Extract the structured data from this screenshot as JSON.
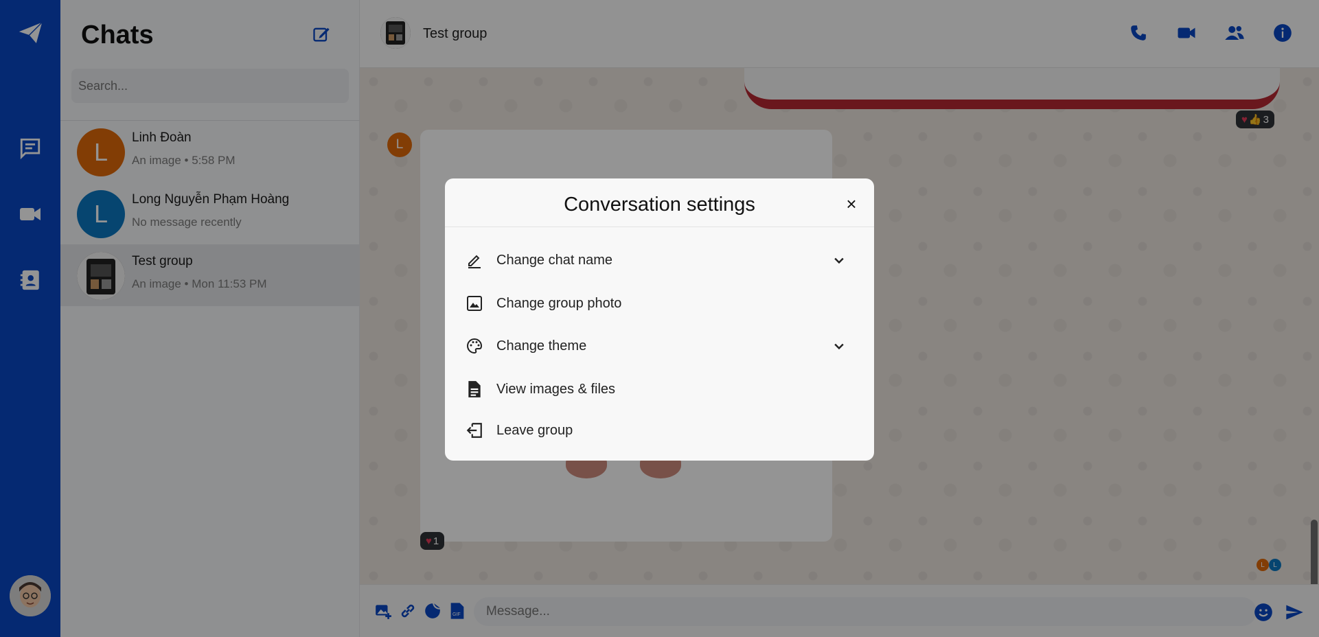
{
  "sidebar": {
    "nav_icons": [
      "paper-plane-icon",
      "chat-icon",
      "video-icon",
      "contacts-icon"
    ],
    "accent": "#0a47c4"
  },
  "chat_list": {
    "title": "Chats",
    "search_placeholder": "Search...",
    "items": [
      {
        "initial": "L",
        "name": "Linh Đoàn",
        "preview": "An image • 5:58 PM",
        "avatar_color": "#e0690a"
      },
      {
        "initial": "L",
        "name": "Long Nguyễn Phạm Hoàng",
        "preview": "No message recently",
        "avatar_color": "#0b78c2"
      },
      {
        "initial": "",
        "name": "Test group",
        "preview": "An image • Mon 11:53 PM",
        "avatar_color": "#3a3a3a"
      }
    ]
  },
  "conversation": {
    "name": "Test group",
    "header_actions": [
      "phone-icon",
      "video-call-icon",
      "members-icon",
      "info-icon"
    ],
    "messages": {
      "top_reactions": {
        "hearts": "♥",
        "likes": "👍",
        "count": "3"
      },
      "sender_initial": "L",
      "image_reactions": {
        "hearts": "♥",
        "count": "1"
      },
      "seen_by": [
        "L",
        "L"
      ]
    },
    "composer": {
      "placeholder": "Message...",
      "tools": [
        "add-image-icon",
        "link-icon",
        "sticker-icon",
        "gif-icon"
      ]
    }
  },
  "modal": {
    "title": "Conversation settings",
    "close_label": "×",
    "options": [
      {
        "label": "Change chat name",
        "icon": "pencil-icon",
        "expandable": true
      },
      {
        "label": "Change group photo",
        "icon": "image-icon",
        "expandable": false
      },
      {
        "label": "Change theme",
        "icon": "palette-icon",
        "expandable": true
      },
      {
        "label": "View images & files",
        "icon": "document-icon",
        "expandable": false
      },
      {
        "label": "Leave group",
        "icon": "leave-icon",
        "expandable": false
      }
    ]
  }
}
